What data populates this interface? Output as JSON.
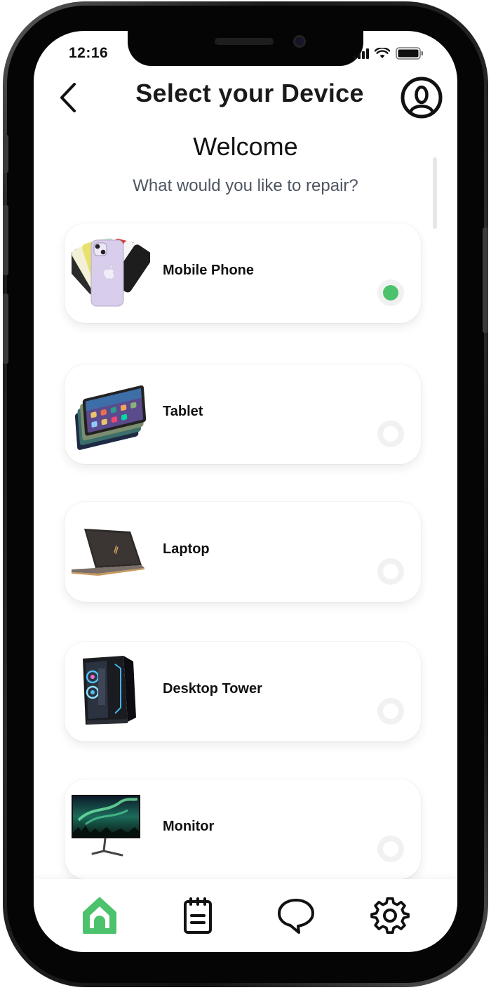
{
  "status_bar": {
    "time": "12:16"
  },
  "header": {
    "title": "Select your Device",
    "back_icon": "chevron-left-icon",
    "profile_icon": "user-circle-icon"
  },
  "welcome": {
    "heading": "Welcome",
    "subtitle": "What would you like to repair?"
  },
  "devices": [
    {
      "label": "Mobile Phone",
      "image": "mobile-phone-image",
      "selected": true
    },
    {
      "label": "Tablet",
      "image": "tablet-image",
      "selected": false
    },
    {
      "label": "Laptop",
      "image": "laptop-image",
      "selected": false
    },
    {
      "label": "Desktop Tower",
      "image": "desktop-tower-image",
      "selected": false
    },
    {
      "label": "Monitor",
      "image": "monitor-image",
      "selected": false
    }
  ],
  "tab_bar": {
    "tabs": [
      {
        "name": "home",
        "icon": "home-icon",
        "active": true
      },
      {
        "name": "notes",
        "icon": "notepad-icon",
        "active": false
      },
      {
        "name": "chat",
        "icon": "chat-bubble-icon",
        "active": false
      },
      {
        "name": "settings",
        "icon": "gear-icon",
        "active": false
      }
    ]
  },
  "colors": {
    "accent": "#4cc26c",
    "text_primary": "#111111",
    "text_secondary": "#4d5560",
    "frame": "#111111"
  }
}
